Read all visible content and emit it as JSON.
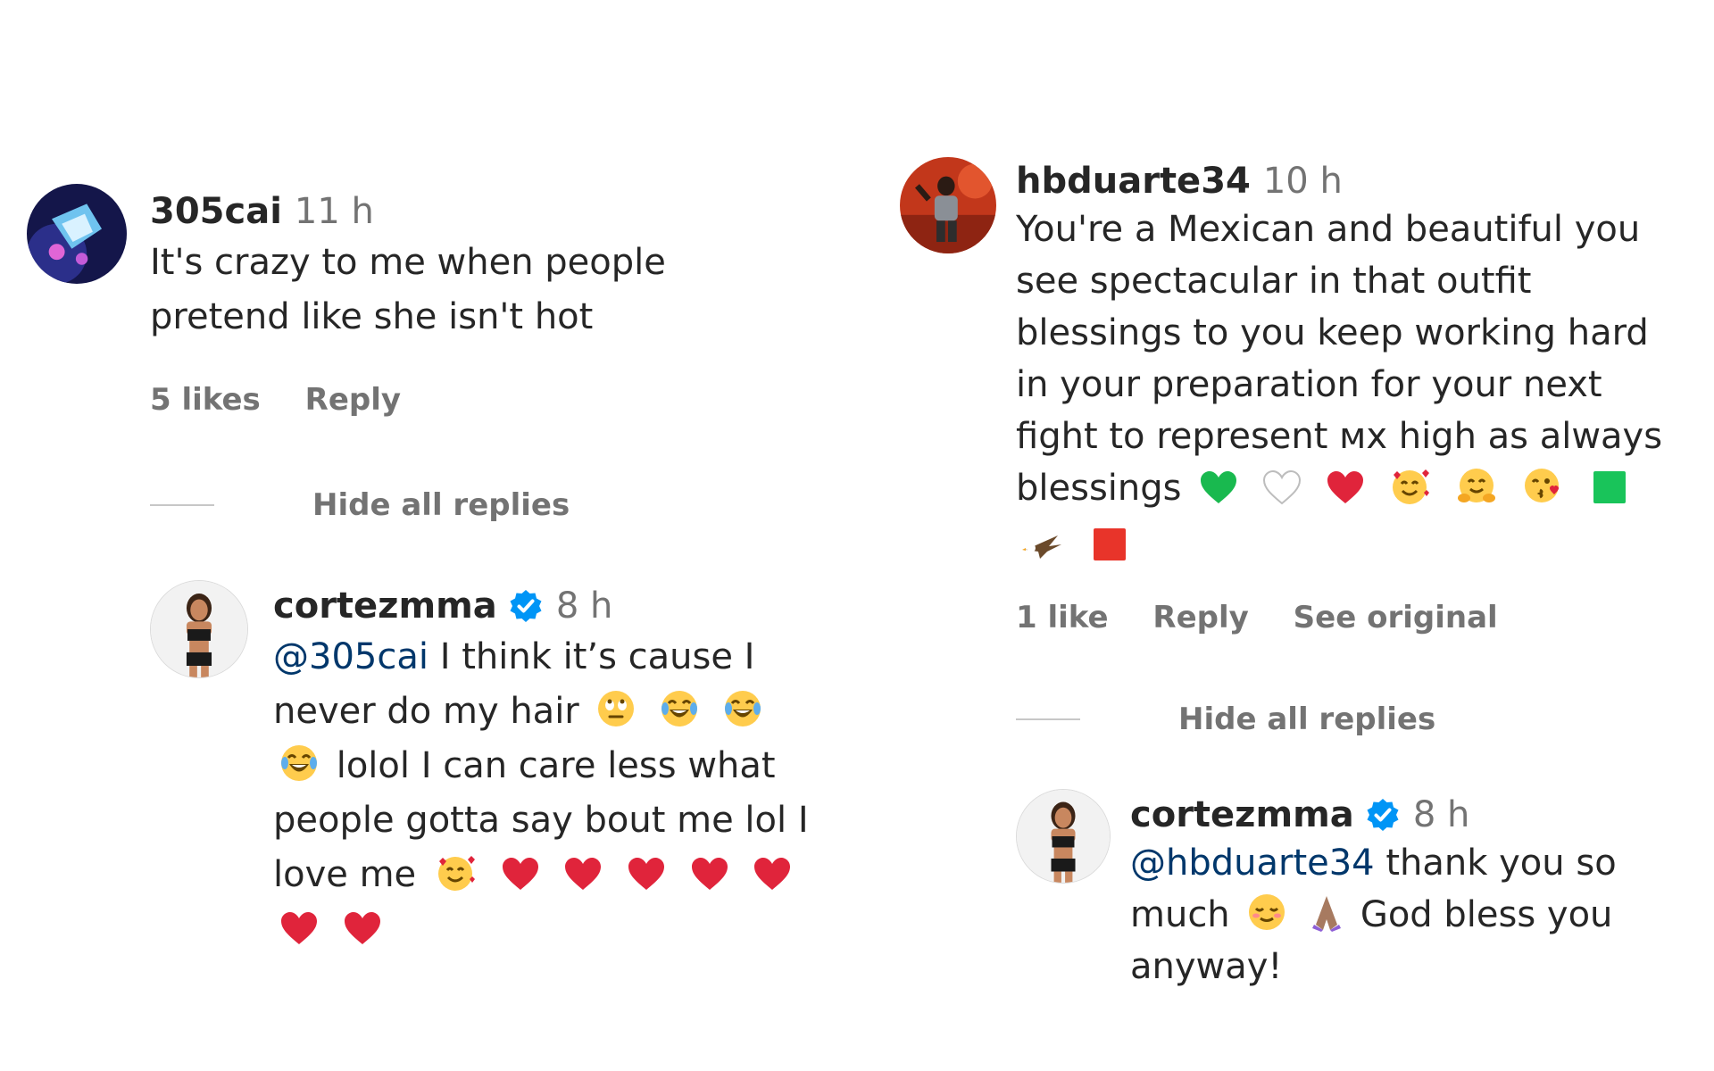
{
  "left": {
    "comment": {
      "username": "305cai",
      "time": "11 h",
      "text": "It's crazy to me when people pretend like she isn't hot",
      "likes": "5 likes",
      "reply": "Reply"
    },
    "hide_replies": "Hide all replies",
    "reply": {
      "username": "cortezmma",
      "time": "8 h",
      "mention": "@305cai",
      "text_1": "I think it’s cause I never do my hair",
      "text_2": "lolol I can care less what people gotta say bout me lol I love me"
    }
  },
  "right": {
    "comment": {
      "username": "hbduarte34",
      "time": "10 h",
      "text": "You're a Mexican and beautiful you see spectacular in that outfit blessings to you keep working hard in your preparation for your next fight to represent ᴍx high as always blessings",
      "likes": "1 like",
      "reply": "Reply",
      "see_original": "See original"
    },
    "hide_replies": "Hide all replies",
    "reply": {
      "username": "cortezmma",
      "time": "8 h",
      "mention": "@hbduarte34",
      "text_1": "thank you so much",
      "text_2": "God bless you anyway!"
    }
  },
  "icons": {
    "verified": "verified-badge-icon",
    "heart": "red-heart-emoji",
    "laugh": "tears-of-joy-emoji"
  },
  "colors": {
    "mention": "#00376b",
    "secondary": "#737373",
    "verified": "#0095f6",
    "heart": "#e0243b"
  }
}
